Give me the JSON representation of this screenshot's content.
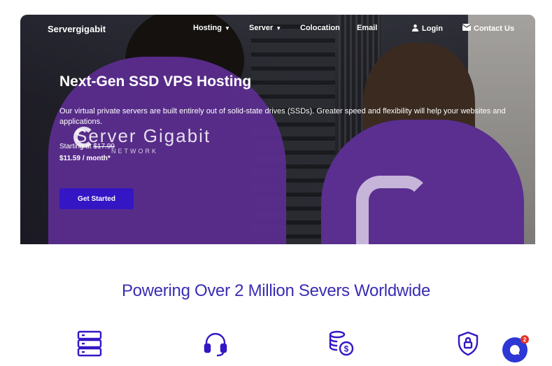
{
  "nav": {
    "brand": "Servergigabit",
    "items": [
      {
        "label": "Hosting",
        "has_caret": true
      },
      {
        "label": "Server",
        "has_caret": true
      },
      {
        "label": "Colocation"
      },
      {
        "label": "Email"
      },
      {
        "label": "Login",
        "icon": "user-icon"
      },
      {
        "label": "Contact Us",
        "icon": "mail-icon"
      }
    ]
  },
  "hero": {
    "title": "Next-Gen SSD VPS Hosting",
    "description": "Our virtual private servers are built entirely out of solid-state drives (SSDs). Greater speed and flexibility will help your websites and applications.",
    "starting_at_label": "Starting at",
    "old_price": "$17.99",
    "new_price": "$11.59 / month*",
    "watermark_text": "Server Gigabit",
    "watermark_sub": "NETWORK",
    "cta_label": "Get Started"
  },
  "section": {
    "headline": "Powering Over 2 Million Severs Worldwide",
    "features": [
      {
        "icon": "server-stack-icon"
      },
      {
        "icon": "headset-icon"
      },
      {
        "icon": "coins-dollar-icon"
      },
      {
        "icon": "shield-lock-icon"
      }
    ]
  },
  "chat": {
    "badge_count": "2"
  },
  "colors": {
    "accent": "#3416c4",
    "headline": "#3a2db3",
    "chat": "#2d37d6",
    "badge": "#e2342c"
  }
}
